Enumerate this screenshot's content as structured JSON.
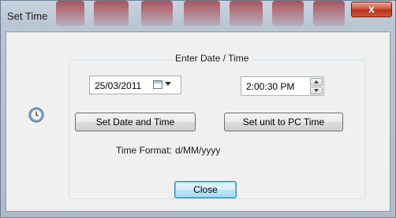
{
  "window": {
    "title": "Set Time",
    "close_glyph": "x"
  },
  "group": {
    "label": "Enter Date / Time"
  },
  "date_picker": {
    "value": "25/03/2011",
    "icon": "calendar-icon"
  },
  "time_picker": {
    "value": "2:00:30 PM"
  },
  "buttons": {
    "set_date_time": "Set Date and Time",
    "set_pc_time": "Set unit to PC Time",
    "close": "Close"
  },
  "time_format": {
    "label": "Time Format:",
    "value": "d/MM/yyyy"
  },
  "icons": {
    "clock": "clock-icon"
  },
  "colors": {
    "title_accent": "#a02832",
    "close_button": "#c84a30",
    "default_button_border": "#3c7fb1"
  }
}
